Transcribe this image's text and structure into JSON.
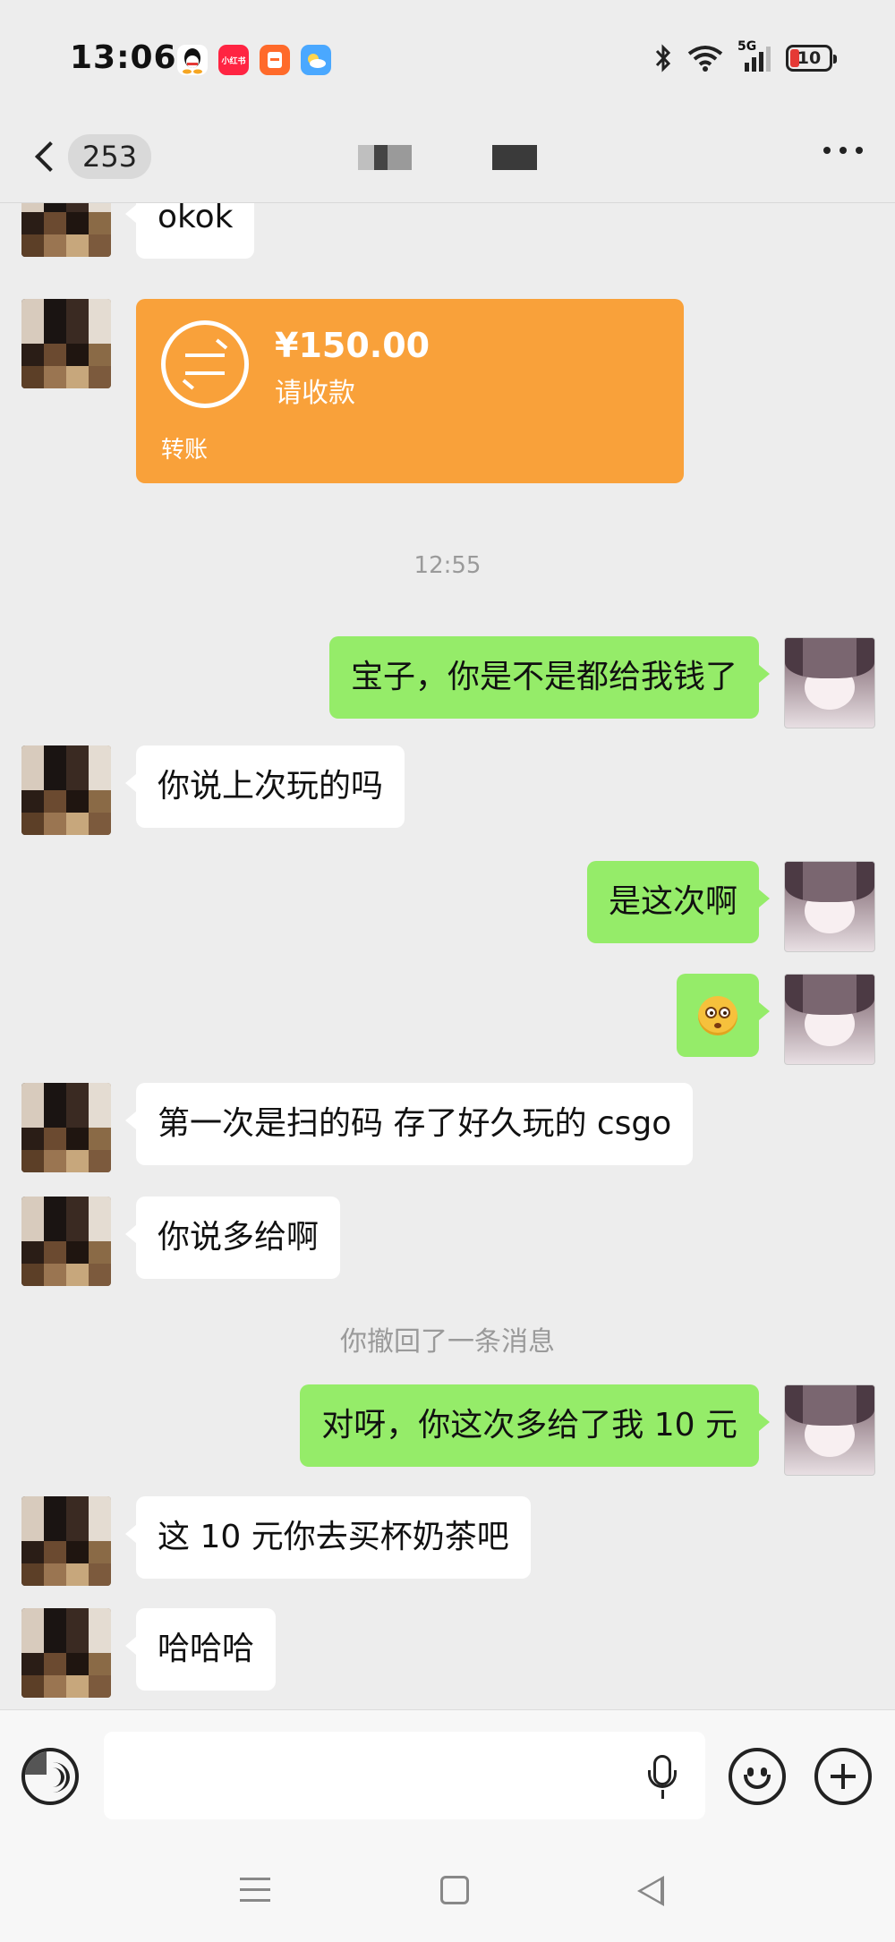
{
  "status_bar": {
    "time": "13:06",
    "app_icons": [
      {
        "name": "qq-icon",
        "label": "",
        "color": "#ffffff"
      },
      {
        "name": "xiaohongshu-icon",
        "label": "小红书",
        "color": "#ff2442"
      },
      {
        "name": "redpacket-app-icon",
        "label": "",
        "color": "#ff6a2a"
      },
      {
        "name": "weather-icon",
        "label": "",
        "color": "#4aa8ff"
      }
    ],
    "network": "5G",
    "battery_level": "10"
  },
  "header": {
    "unread_count": "253"
  },
  "messages": [
    {
      "from": "other",
      "type": "text",
      "text": "okok"
    },
    {
      "from": "other",
      "type": "transfer",
      "amount": "¥150.00",
      "subtitle": "请收款",
      "footer": "转账",
      "color": "#f9a13a"
    },
    {
      "type": "timestamp",
      "text": "12:55"
    },
    {
      "from": "me",
      "type": "text",
      "text": "宝子，你是不是都给我钱了"
    },
    {
      "from": "other",
      "type": "text",
      "text": "你说上次玩的吗"
    },
    {
      "from": "me",
      "type": "text",
      "text": "是这次啊"
    },
    {
      "from": "me",
      "type": "emoji",
      "emoji": "flushed-face-icon"
    },
    {
      "from": "other",
      "type": "text",
      "text": "第一次是扫的码 存了好久玩的 csgo"
    },
    {
      "from": "other",
      "type": "text",
      "text": "你说多给啊"
    },
    {
      "type": "system",
      "text": "你撤回了一条消息"
    },
    {
      "from": "me",
      "type": "text",
      "text": "对呀，你这次多给了我 10 元"
    },
    {
      "from": "other",
      "type": "text",
      "text": "这 10 元你去买杯奶茶吧"
    },
    {
      "from": "other",
      "type": "text",
      "text": "哈哈哈"
    }
  ],
  "input_bar": {
    "placeholder": "",
    "value": ""
  },
  "colors": {
    "outgoing_bubble": "#95ec69",
    "incoming_bubble": "#ffffff",
    "background": "#ededed"
  }
}
